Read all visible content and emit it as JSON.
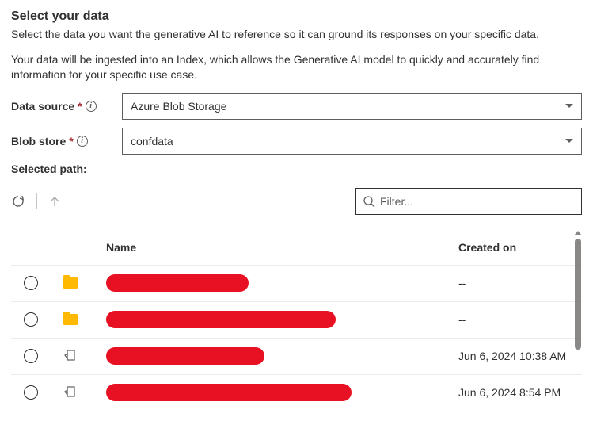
{
  "header": {
    "title": "Select your data",
    "desc1": "Select the data you want the generative AI to reference so it can ground its responses on your specific data.",
    "desc2": "Your data will be ingested into an Index, which allows the Generative AI model to quickly and accurately find information for your specific use case."
  },
  "form": {
    "data_source_label": "Data source",
    "data_source_value": "Azure Blob Storage",
    "blob_store_label": "Blob store",
    "blob_store_value": "confdata",
    "selected_path_label": "Selected path:"
  },
  "filter": {
    "placeholder": "Filter..."
  },
  "columns": {
    "name": "Name",
    "created": "Created on"
  },
  "rows": [
    {
      "type": "folder",
      "created": "--",
      "redact_w": 180
    },
    {
      "type": "folder",
      "created": "--",
      "redact_w": 290
    },
    {
      "type": "file",
      "created": "Jun 6, 2024 10:38 AM",
      "redact_w": 200
    },
    {
      "type": "file",
      "created": "Jun 6, 2024 8:54 PM",
      "redact_w": 310
    }
  ]
}
